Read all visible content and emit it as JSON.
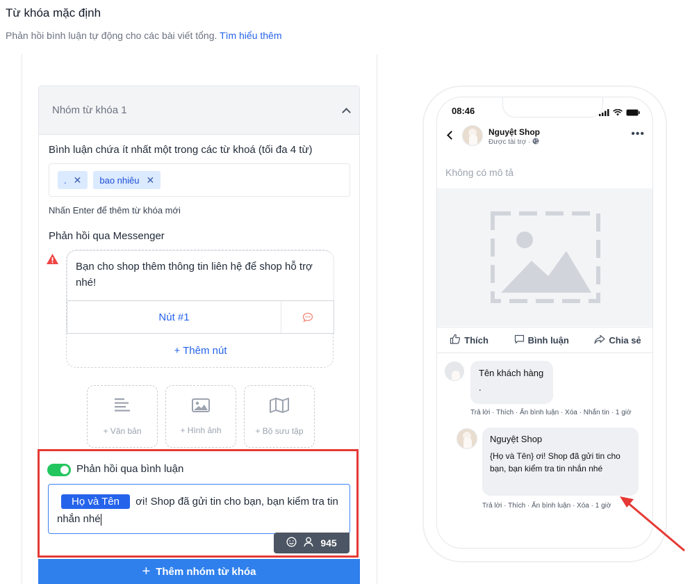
{
  "header": {
    "title": "Từ khóa mặc định",
    "subtitle": "Phản hồi bình luận tự động cho các bài viết tổng.",
    "learn_more": "Tìm hiểu thêm"
  },
  "group": {
    "title": "Nhóm từ khóa 1",
    "keywords_label": "Bình luận chứa ít nhất một trong các từ khoá (tối đa 4 từ)",
    "keywords": [
      ".",
      "bao nhiêu"
    ],
    "keywords_hint": "Nhấn Enter để thêm từ khóa mới",
    "messenger_label": "Phản hồi qua Messenger",
    "message_text": "Bạn cho shop thêm thông tin liên hệ để shop hỗ trợ nhé!",
    "button1_label": "Nút #1",
    "add_button_label": "+ Thêm nút",
    "tiles": [
      "+ Văn bản",
      "+ Hình ảnh",
      "+ Bộ sưu tập"
    ],
    "comment_reply_label": "Phản hồi qua bình luận",
    "comment_reply_toggle_on": true,
    "reply_chip": "Họ và Tên",
    "reply_text": "ơi! Shop đã gửi tin cho bạn, bạn kiểm tra tin nhắn nhé",
    "char_count": "945"
  },
  "add_group_label": "Thêm nhóm từ khóa",
  "preview": {
    "time": "08:46",
    "page_name": "Nguyệt Shop",
    "sponsored": "Được tài trợ ·",
    "no_description": "Không có mô tả",
    "actions": [
      "Thích",
      "Bình luận",
      "Chia sẻ"
    ],
    "customer": {
      "name": "Tên khách hàng",
      "text": ".",
      "meta": "Trả lời · Thích · Ẩn bình luận · Xóa · Nhắn tin · 1 giờ"
    },
    "shop_reply": {
      "name": "Nguyệt Shop",
      "text": "{Họ và Tên} ơi! Shop đã gửi tin cho bạn, bạn kiểm tra tin nhắn nhé",
      "meta": "Trả lời · Thích · Ẩn bình luận · Xóa · 1 giờ"
    }
  },
  "colors": {
    "accent": "#2563eb",
    "highlight_border": "#e53935",
    "toggle_on": "#22c55e",
    "add_group_bg": "#2f80ed"
  }
}
